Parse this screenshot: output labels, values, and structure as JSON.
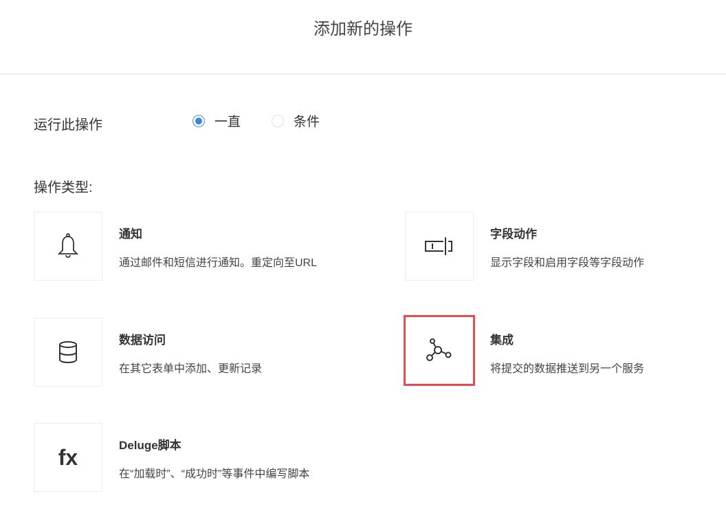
{
  "header": {
    "title": "添加新的操作"
  },
  "run": {
    "label": "运行此操作",
    "options": [
      {
        "label": "一直",
        "selected": true
      },
      {
        "label": "条件",
        "selected": false
      }
    ]
  },
  "types": {
    "label": "操作类型:",
    "cards": [
      {
        "icon": "bell-icon",
        "title": "通知",
        "desc": "通过邮件和短信进行通知。重定向至URL"
      },
      {
        "icon": "field-action-icon",
        "title": "字段动作",
        "desc": "显示字段和启用字段等字段动作"
      },
      {
        "icon": "database-icon",
        "title": "数据访问",
        "desc": "在其它表单中添加、更新记录"
      },
      {
        "icon": "integration-icon",
        "title": "集成",
        "desc": "将提交的数据推送到另一个服务",
        "highlighted": true
      },
      {
        "icon": "fx-icon",
        "icon_text": "fx",
        "title": "Deluge脚本",
        "desc": "在“加载时”、“成功时”等事件中编写脚本"
      }
    ]
  },
  "colors": {
    "highlight": "#e84a4f",
    "radio": "#3b86dd"
  }
}
